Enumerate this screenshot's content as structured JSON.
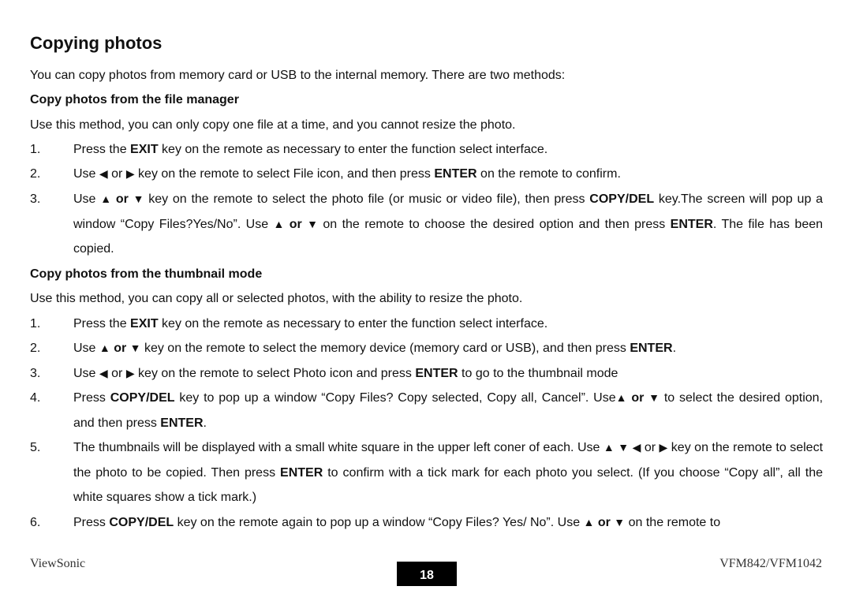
{
  "title": "Copying photos",
  "intro": "You can copy photos from memory card or USB to the internal memory. There are two methods:",
  "section1": {
    "heading": "Copy photos from the file manager",
    "desc": "Use this method, you can only copy one file at a time, and you cannot resize the photo.",
    "steps": [
      {
        "num": "1.",
        "parts": [
          {
            "t": "Press the "
          },
          {
            "t": "EXIT",
            "b": true
          },
          {
            "t": " key on the remote as necessary to enter the function select interface."
          }
        ]
      },
      {
        "num": "2.",
        "parts": [
          {
            "t": "Use "
          },
          {
            "icon": "left"
          },
          {
            "t": " or "
          },
          {
            "icon": "right"
          },
          {
            "t": " key on the remote to select File icon, and then press "
          },
          {
            "t": "ENTER",
            "b": true
          },
          {
            "t": " on the remote to confirm."
          }
        ]
      },
      {
        "num": "3.",
        "parts": [
          {
            "t": "Use "
          },
          {
            "icon": "up"
          },
          {
            "t": " or ",
            "b": true
          },
          {
            "icon": "down"
          },
          {
            "t": " key on the remote to select the photo file (or music or video file), then press "
          },
          {
            "t": "COPY/DEL",
            "b": true
          },
          {
            "t": " key.The screen will pop up a window “Copy Files?Yes/No”. Use "
          },
          {
            "icon": "up"
          },
          {
            "t": " or ",
            "b": true
          },
          {
            "icon": "down"
          },
          {
            "t": " on the remote to choose the desired option and then press "
          },
          {
            "t": "ENTER",
            "b": true
          },
          {
            "t": ". The file has been copied."
          }
        ]
      }
    ]
  },
  "section2": {
    "heading": "Copy photos from the thumbnail mode",
    "desc": "Use this method, you can copy all or selected photos, with the ability to resize the photo.",
    "steps": [
      {
        "num": "1.",
        "parts": [
          {
            "t": "Press the "
          },
          {
            "t": "EXIT",
            "b": true
          },
          {
            "t": " key on the remote as necessary to enter the function select interface."
          }
        ]
      },
      {
        "num": "2.",
        "parts": [
          {
            "t": "Use "
          },
          {
            "icon": "up"
          },
          {
            "t": " or ",
            "b": true
          },
          {
            "icon": "down"
          },
          {
            "t": " key on the remote to select the memory device (memory card or USB), and then press "
          },
          {
            "t": "ENTER",
            "b": true
          },
          {
            "t": "."
          }
        ]
      },
      {
        "num": "3.",
        "parts": [
          {
            "t": "Use "
          },
          {
            "icon": "left"
          },
          {
            "t": " or "
          },
          {
            "icon": "right"
          },
          {
            "t": " key on the remote to select Photo icon and press "
          },
          {
            "t": "ENTER",
            "b": true
          },
          {
            "t": " to go to the thumbnail mode"
          }
        ]
      },
      {
        "num": "4.",
        "parts": [
          {
            "t": "Press "
          },
          {
            "t": "COPY/DEL",
            "b": true
          },
          {
            "t": " key to pop up a window “Copy Files? Copy selected, Copy all, Cancel”. Use"
          },
          {
            "icon": "up"
          },
          {
            "t": " or ",
            "b": true
          },
          {
            "icon": "down"
          },
          {
            "t": " to select the desired option, and then press "
          },
          {
            "t": "ENTER",
            "b": true
          },
          {
            "t": "."
          }
        ]
      },
      {
        "num": "5.",
        "parts": [
          {
            "t": "The thumbnails will be displayed with a small white square in the upper left coner of each. Use "
          },
          {
            "icon": "up"
          },
          {
            "t": " "
          },
          {
            "icon": "down"
          },
          {
            "t": " "
          },
          {
            "icon": "left"
          },
          {
            "t": " or "
          },
          {
            "icon": "right"
          },
          {
            "t": " key on the remote to select the photo to be copied. Then press "
          },
          {
            "t": "ENTER",
            "b": true
          },
          {
            "t": " to confirm with a tick mark for each photo you select. (If you choose “Copy all”, all the white squares show a tick mark.)"
          }
        ]
      },
      {
        "num": "6.",
        "parts": [
          {
            "t": "Press "
          },
          {
            "t": "COPY/DEL",
            "b": true
          },
          {
            "t": " key on the remote again to pop up a window “Copy Files? Yes/ No”. Use "
          },
          {
            "icon": "up"
          },
          {
            "t": " or ",
            "b": true
          },
          {
            "icon": "down"
          },
          {
            "t": " on the remote to"
          }
        ]
      }
    ]
  },
  "icons": {
    "up": "▲",
    "down": "▼",
    "left": "◀",
    "right": "▶"
  },
  "footer": {
    "brand": "ViewSonic",
    "page": "18",
    "model": "VFM842/VFM1042"
  }
}
